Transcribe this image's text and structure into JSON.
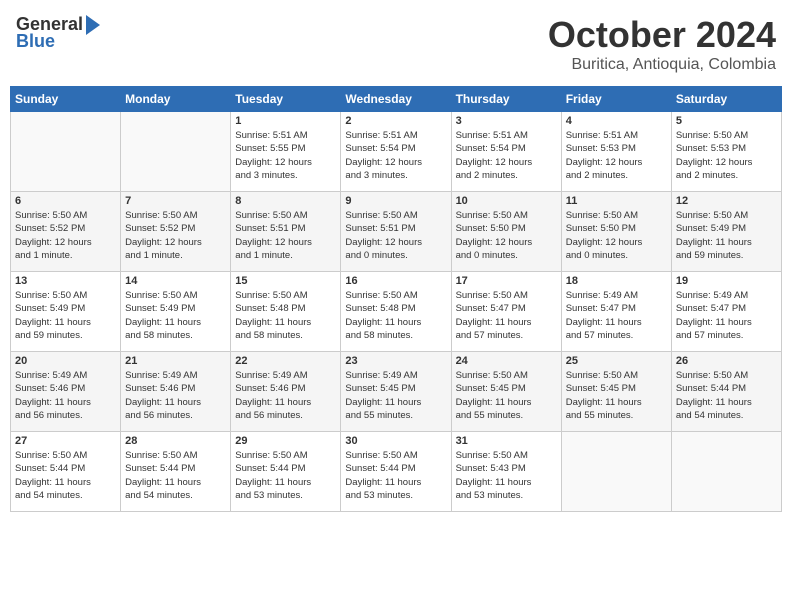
{
  "header": {
    "logo_general": "General",
    "logo_blue": "Blue",
    "month": "October 2024",
    "location": "Buritica, Antioquia, Colombia"
  },
  "days_of_week": [
    "Sunday",
    "Monday",
    "Tuesday",
    "Wednesday",
    "Thursday",
    "Friday",
    "Saturday"
  ],
  "weeks": [
    [
      {
        "day": "",
        "info": ""
      },
      {
        "day": "",
        "info": ""
      },
      {
        "day": "1",
        "info": "Sunrise: 5:51 AM\nSunset: 5:55 PM\nDaylight: 12 hours\nand 3 minutes."
      },
      {
        "day": "2",
        "info": "Sunrise: 5:51 AM\nSunset: 5:54 PM\nDaylight: 12 hours\nand 3 minutes."
      },
      {
        "day": "3",
        "info": "Sunrise: 5:51 AM\nSunset: 5:54 PM\nDaylight: 12 hours\nand 2 minutes."
      },
      {
        "day": "4",
        "info": "Sunrise: 5:51 AM\nSunset: 5:53 PM\nDaylight: 12 hours\nand 2 minutes."
      },
      {
        "day": "5",
        "info": "Sunrise: 5:50 AM\nSunset: 5:53 PM\nDaylight: 12 hours\nand 2 minutes."
      }
    ],
    [
      {
        "day": "6",
        "info": "Sunrise: 5:50 AM\nSunset: 5:52 PM\nDaylight: 12 hours\nand 1 minute."
      },
      {
        "day": "7",
        "info": "Sunrise: 5:50 AM\nSunset: 5:52 PM\nDaylight: 12 hours\nand 1 minute."
      },
      {
        "day": "8",
        "info": "Sunrise: 5:50 AM\nSunset: 5:51 PM\nDaylight: 12 hours\nand 1 minute."
      },
      {
        "day": "9",
        "info": "Sunrise: 5:50 AM\nSunset: 5:51 PM\nDaylight: 12 hours\nand 0 minutes."
      },
      {
        "day": "10",
        "info": "Sunrise: 5:50 AM\nSunset: 5:50 PM\nDaylight: 12 hours\nand 0 minutes."
      },
      {
        "day": "11",
        "info": "Sunrise: 5:50 AM\nSunset: 5:50 PM\nDaylight: 12 hours\nand 0 minutes."
      },
      {
        "day": "12",
        "info": "Sunrise: 5:50 AM\nSunset: 5:49 PM\nDaylight: 11 hours\nand 59 minutes."
      }
    ],
    [
      {
        "day": "13",
        "info": "Sunrise: 5:50 AM\nSunset: 5:49 PM\nDaylight: 11 hours\nand 59 minutes."
      },
      {
        "day": "14",
        "info": "Sunrise: 5:50 AM\nSunset: 5:49 PM\nDaylight: 11 hours\nand 58 minutes."
      },
      {
        "day": "15",
        "info": "Sunrise: 5:50 AM\nSunset: 5:48 PM\nDaylight: 11 hours\nand 58 minutes."
      },
      {
        "day": "16",
        "info": "Sunrise: 5:50 AM\nSunset: 5:48 PM\nDaylight: 11 hours\nand 58 minutes."
      },
      {
        "day": "17",
        "info": "Sunrise: 5:50 AM\nSunset: 5:47 PM\nDaylight: 11 hours\nand 57 minutes."
      },
      {
        "day": "18",
        "info": "Sunrise: 5:49 AM\nSunset: 5:47 PM\nDaylight: 11 hours\nand 57 minutes."
      },
      {
        "day": "19",
        "info": "Sunrise: 5:49 AM\nSunset: 5:47 PM\nDaylight: 11 hours\nand 57 minutes."
      }
    ],
    [
      {
        "day": "20",
        "info": "Sunrise: 5:49 AM\nSunset: 5:46 PM\nDaylight: 11 hours\nand 56 minutes."
      },
      {
        "day": "21",
        "info": "Sunrise: 5:49 AM\nSunset: 5:46 PM\nDaylight: 11 hours\nand 56 minutes."
      },
      {
        "day": "22",
        "info": "Sunrise: 5:49 AM\nSunset: 5:46 PM\nDaylight: 11 hours\nand 56 minutes."
      },
      {
        "day": "23",
        "info": "Sunrise: 5:49 AM\nSunset: 5:45 PM\nDaylight: 11 hours\nand 55 minutes."
      },
      {
        "day": "24",
        "info": "Sunrise: 5:50 AM\nSunset: 5:45 PM\nDaylight: 11 hours\nand 55 minutes."
      },
      {
        "day": "25",
        "info": "Sunrise: 5:50 AM\nSunset: 5:45 PM\nDaylight: 11 hours\nand 55 minutes."
      },
      {
        "day": "26",
        "info": "Sunrise: 5:50 AM\nSunset: 5:44 PM\nDaylight: 11 hours\nand 54 minutes."
      }
    ],
    [
      {
        "day": "27",
        "info": "Sunrise: 5:50 AM\nSunset: 5:44 PM\nDaylight: 11 hours\nand 54 minutes."
      },
      {
        "day": "28",
        "info": "Sunrise: 5:50 AM\nSunset: 5:44 PM\nDaylight: 11 hours\nand 54 minutes."
      },
      {
        "day": "29",
        "info": "Sunrise: 5:50 AM\nSunset: 5:44 PM\nDaylight: 11 hours\nand 53 minutes."
      },
      {
        "day": "30",
        "info": "Sunrise: 5:50 AM\nSunset: 5:44 PM\nDaylight: 11 hours\nand 53 minutes."
      },
      {
        "day": "31",
        "info": "Sunrise: 5:50 AM\nSunset: 5:43 PM\nDaylight: 11 hours\nand 53 minutes."
      },
      {
        "day": "",
        "info": ""
      },
      {
        "day": "",
        "info": ""
      }
    ]
  ]
}
